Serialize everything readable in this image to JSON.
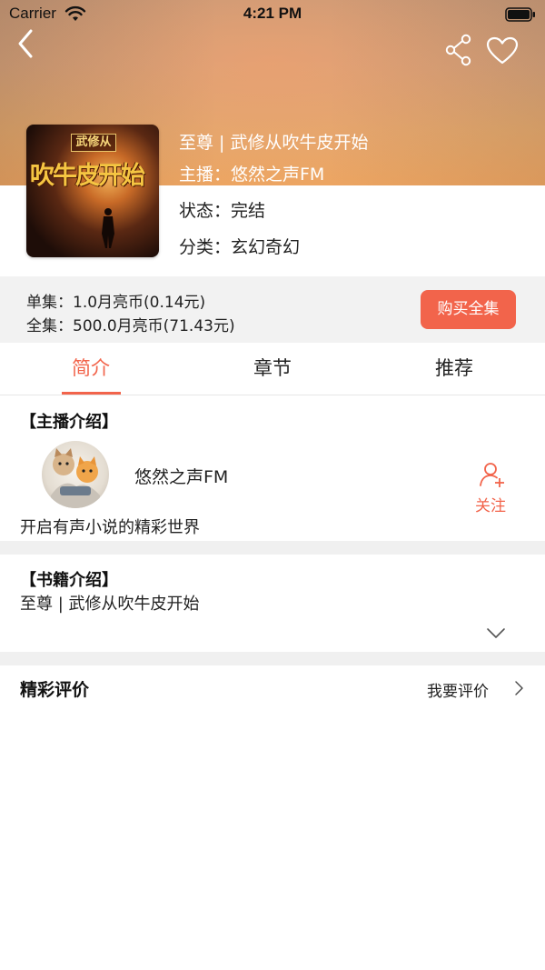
{
  "status_bar": {
    "carrier": "Carrier",
    "time": "4:21 PM"
  },
  "nav": {
    "back_icon": "chevron-left-icon",
    "share_icon": "share-icon",
    "favorite_icon": "heart-icon"
  },
  "book": {
    "cover_text_top": "武修从",
    "cover_text_main": "吹牛皮开始",
    "title": "至尊 | 武修从吹牛皮开始",
    "host": "主播：悠然之声FM",
    "status": "状态：完结",
    "category": "分类：玄幻奇幻"
  },
  "pricing": {
    "single": "单集：1.0月亮币(0.14元)",
    "full": "全集：500.0月亮币(71.43元)",
    "buy_label": "购买全集"
  },
  "tabs": [
    {
      "label": "简介",
      "active": true
    },
    {
      "label": "章节",
      "active": false
    },
    {
      "label": "推荐",
      "active": false
    }
  ],
  "host_section": {
    "title": "【主播介绍】",
    "name": "悠然之声FM",
    "follow_label": "关注",
    "description": "开启有声小说的精彩世界"
  },
  "book_section": {
    "title": "【书籍介绍】",
    "description": "至尊 | 武修从吹牛皮开始"
  },
  "reviews": {
    "title": "精彩评价",
    "write_label": "我要评价"
  },
  "colors": {
    "accent": "#f2644b",
    "strip_bg": "#f2f2f2",
    "divider": "#f0f0f0"
  }
}
